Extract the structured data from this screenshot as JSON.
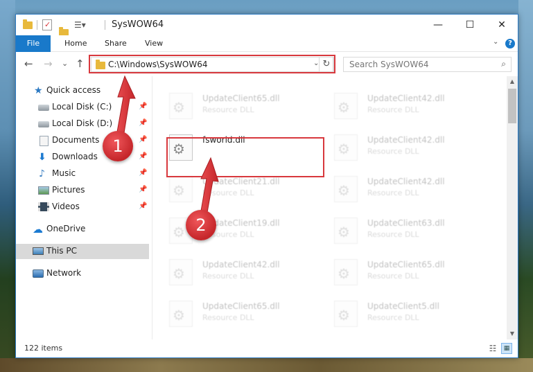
{
  "window": {
    "title": "SysWOW64",
    "minimize": "—",
    "maximize": "☐",
    "close": "✕"
  },
  "ribbon": {
    "file": "File",
    "home": "Home",
    "share": "Share",
    "view": "View",
    "help": "?"
  },
  "nav": {
    "back": "←",
    "forward": "→",
    "recent": "⌄",
    "up": "↑",
    "address": "C:\\Windows\\SysWOW64",
    "address_chevron": "⌄",
    "refresh": "↻",
    "search_placeholder": "Search SysWOW64"
  },
  "sidebar": {
    "items": [
      {
        "label": "Quick access"
      },
      {
        "label": "Local Disk (C:)"
      },
      {
        "label": "Local Disk (D:)"
      },
      {
        "label": "Documents"
      },
      {
        "label": "Downloads"
      },
      {
        "label": "Music"
      },
      {
        "label": "Pictures"
      },
      {
        "label": "Videos"
      },
      {
        "label": "OneDrive"
      },
      {
        "label": "This PC"
      },
      {
        "label": "Network"
      }
    ]
  },
  "files": [
    {
      "name": "UpdateClient65.dll",
      "type": "Resource DLL"
    },
    {
      "name": "UpdateClient42.dll",
      "type": "Resource DLL"
    },
    {
      "name": "fsworld.dll",
      "type": ""
    },
    {
      "name": "UpdateClient42.dll",
      "type": "Resource DLL"
    },
    {
      "name": "UpdateClient21.dll",
      "type": "Resource DLL"
    },
    {
      "name": "UpdateClient42.dll",
      "type": "Resource DLL"
    },
    {
      "name": "UpdateClient19.dll",
      "type": "Resource DLL"
    },
    {
      "name": "UpdateClient63.dll",
      "type": "Resource DLL"
    },
    {
      "name": "UpdateClient42.dll",
      "type": "Resource DLL"
    },
    {
      "name": "UpdateClient65.dll",
      "type": "Resource DLL"
    },
    {
      "name": "UpdateClient65.dll",
      "type": "Resource DLL"
    },
    {
      "name": "UpdateClient5.dll",
      "type": "Resource DLL"
    }
  ],
  "status": {
    "items": "122 items"
  },
  "callouts": {
    "one": "1",
    "two": "2"
  },
  "colors": {
    "accent": "#1979ca",
    "highlight": "#d8383d"
  }
}
